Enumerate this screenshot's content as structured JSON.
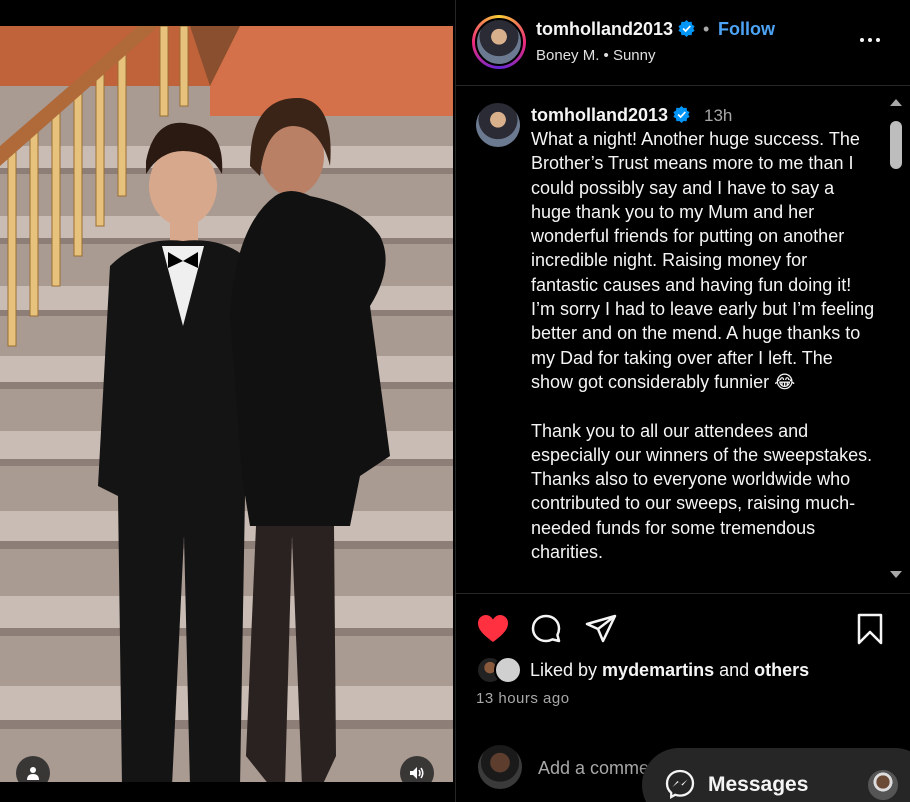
{
  "post": {
    "username": "tomholland2013",
    "verified": true,
    "separator": "•",
    "follow_label": "Follow",
    "audio": "Boney M. • Sunny",
    "caption_time": "13h",
    "caption_text": "What a night! Another huge success. The Brother’s Trust means more to me than I could possibly say and I have to say a huge thank you to my Mum and her wonderful friends for putting on another incredible night. Raising money for fantastic causes and having fun doing it! I’m sorry I had to leave early but I’m feeling better and on the mend. A huge thanks to my Dad for taking over after I left. The show got considerably funnier 😂\n\nThank you to all our attendees and especially our winners of the sweepstakes. Thanks also to everyone worldwide who contributed to our sweeps, raising much-needed funds for some tremendous charities.",
    "liked_by_prefix": "Liked by ",
    "liked_by_user": "mydemartins",
    "liked_by_suffix_and": " and ",
    "liked_by_others": "others",
    "time_ago": "13 hours ago",
    "comment_placeholder": "Add a comme"
  },
  "messages": {
    "label": "Messages"
  },
  "icons": {
    "like": "heart-filled-icon",
    "comment": "comment-icon",
    "share": "send-icon",
    "save": "bookmark-icon",
    "more": "more-options-icon",
    "user_tag": "user-icon",
    "sound": "sound-on-icon",
    "messenger": "messenger-icon"
  },
  "colors": {
    "like": "#ff3040",
    "follow": "#4da3f5",
    "verified": "#0095f6",
    "muted_text": "#a8a8a8"
  }
}
